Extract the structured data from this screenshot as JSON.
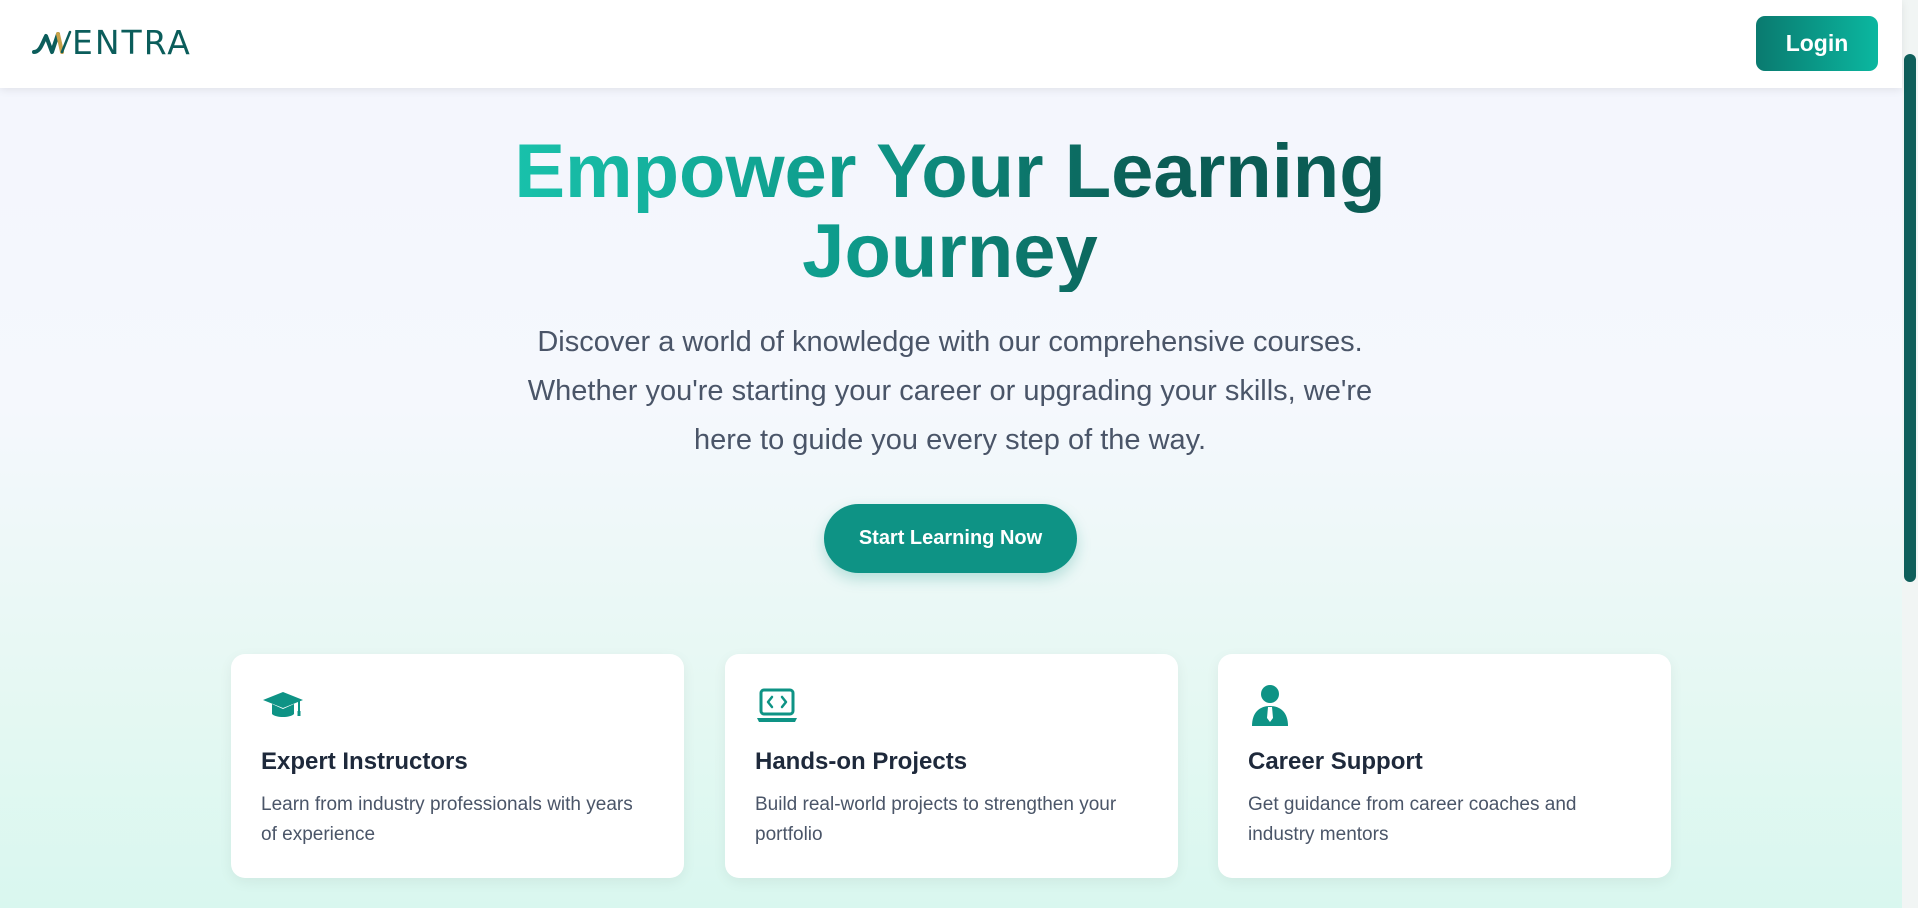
{
  "nav": {
    "logo_text": "ENTRA",
    "logo_mark": "M",
    "login_label": "Login"
  },
  "hero": {
    "title_line1": "Empower Your Learning",
    "title_line2": "Journey",
    "subtitle_line1": "Discover a world of knowledge with our comprehensive courses.",
    "subtitle_line2": "Whether you're starting your career or upgrading your skills, we're",
    "subtitle_line3": "here to guide you every step of the way.",
    "cta_label": "Start Learning Now"
  },
  "features": [
    {
      "icon": "graduation-cap-icon",
      "title": "Expert Instructors",
      "desc": "Learn from industry professionals with years of experience"
    },
    {
      "icon": "laptop-code-icon",
      "title": "Hands-on Projects",
      "desc": "Build real-world projects to strengthen your portfolio"
    },
    {
      "icon": "user-tie-icon",
      "title": "Career Support",
      "desc": "Get guidance from career coaches and industry mentors"
    }
  ],
  "colors": {
    "brand": "#0e9385",
    "brand_dark": "#0b5d5b",
    "accent_light": "#1bc9b1",
    "logo_gold": "#c9a24a"
  }
}
